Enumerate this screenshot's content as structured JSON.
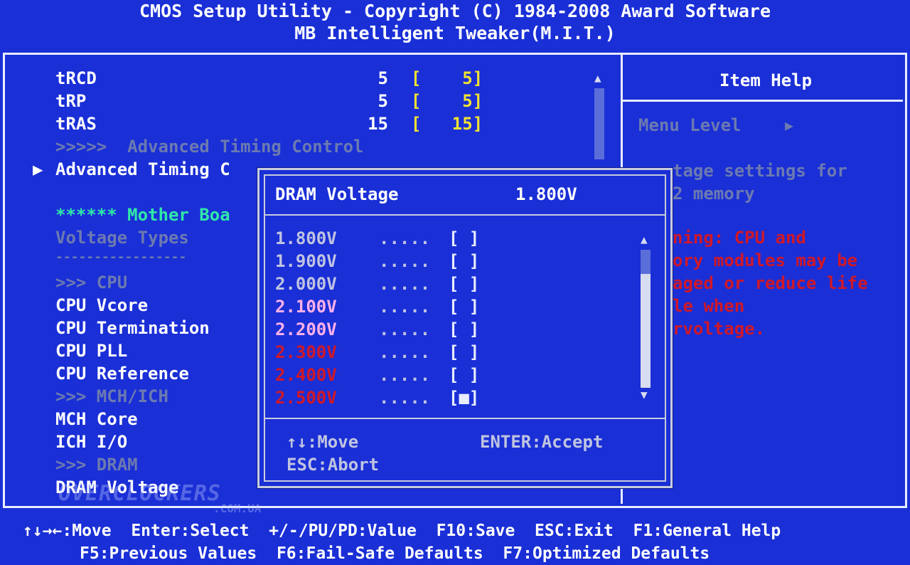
{
  "header": {
    "line1": "CMOS Setup Utility - Copyright (C) 1984-2008 Award Software",
    "line2": "MB Intelligent Tweaker(M.I.T.)"
  },
  "left": {
    "rows": [
      {
        "label": "tRCD",
        "value": "5",
        "setting": "[    5]"
      },
      {
        "label": "tRP",
        "value": "5",
        "setting": "[    5]"
      },
      {
        "label": "tRAS",
        "value": "15",
        "setting": "[   15]"
      }
    ],
    "adv_timing_header": ">>>>>  Advanced Timing Control",
    "adv_timing_item": "Advanced Timing C",
    "mb_header": "****** Mother Boa",
    "voltage_types": "Voltage Types",
    "dashes": "-----------------",
    "cpu_section": ">>> CPU",
    "cpu_vcore": "CPU Vcore",
    "cpu_termination": "CPU Termination",
    "cpu_pll": "CPU PLL",
    "cpu_reference": "CPU Reference",
    "mch_section": ">>> MCH/ICH",
    "mch_core": "MCH Core",
    "ich_io": "ICH I/O",
    "dram_section": ">>> DRAM",
    "dram_voltage": "DRAM Voltage"
  },
  "help": {
    "title": "Item Help",
    "menu_level": "Menu Level",
    "menu_level_arrow": "▶",
    "lines": [
      "tage settings for",
      "2 memory"
    ],
    "warning": [
      "ning: CPU and",
      "ory modules may be",
      "aged or reduce life",
      "le when",
      "rvoltage."
    ]
  },
  "popup": {
    "title": "DRAM Voltage",
    "current": "1.800V",
    "options": [
      {
        "value": "1.800V",
        "dots": ".....",
        "mark": "[ ]",
        "tone": "grey"
      },
      {
        "value": "1.900V",
        "dots": ".....",
        "mark": "[ ]",
        "tone": "grey"
      },
      {
        "value": "2.000V",
        "dots": ".....",
        "mark": "[ ]",
        "tone": "grey"
      },
      {
        "value": "2.100V",
        "dots": ".....",
        "mark": "[ ]",
        "tone": "pink"
      },
      {
        "value": "2.200V",
        "dots": ".....",
        "mark": "[ ]",
        "tone": "pink"
      },
      {
        "value": "2.300V",
        "dots": ".....",
        "mark": "[ ]",
        "tone": "red"
      },
      {
        "value": "2.400V",
        "dots": ".....",
        "mark": "[ ]",
        "tone": "red"
      },
      {
        "value": "2.500V",
        "dots": ".....",
        "mark": "[■]",
        "tone": "red"
      }
    ],
    "hint_move": "↑↓:Move",
    "hint_accept": "ENTER:Accept",
    "hint_abort": "ESC:Abort"
  },
  "footer": {
    "line1": "↑↓→←:Move  Enter:Select  +/-/PU/PD:Value  F10:Save  ESC:Exit  F1:General Help",
    "line2": "F5:Previous Values  F6:Fail-Safe Defaults  F7:Optimized Defaults"
  },
  "watermark": {
    "main": "OVERCLOCKERS",
    "sub": ".COM.UA"
  },
  "colors": {
    "background": "#1a2fd6",
    "setting_yellow": "#f2e230",
    "section_green": "#30e8a8",
    "warning_red": "#d01828",
    "disabled": "#6c7ab0"
  }
}
